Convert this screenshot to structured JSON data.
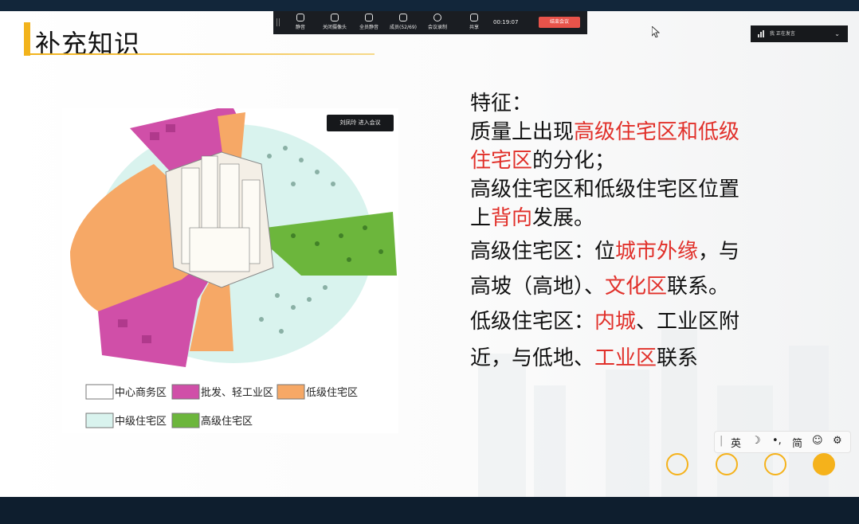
{
  "slide": {
    "title": "补充知识",
    "notes": {
      "heading": "特征：",
      "l1a": "质量上出现",
      "l1b": "高级住宅区和低级",
      "l2a": "住宅区",
      "l2b": "的分化；",
      "l3": "高级住宅区和低级住宅区位置",
      "l4a": "上",
      "l4b": "背向",
      "l4c": "发展。",
      "l5a": "高级住宅区：位",
      "l5b": "城市外缘",
      "l5c": "，与",
      "l6a": "高坡（高地）、",
      "l6b": "文化区",
      "l6c": "联系。",
      "l7a": "低级住宅区：",
      "l7b": "内城",
      "l7c": "、工业区附",
      "l8a": "近，与低地、",
      "l8b": "工业区",
      "l8c": "联系"
    },
    "legend": {
      "cbd": "中心商务区",
      "industry": "批发、轻工业区",
      "low": "低级住宅区",
      "mid": "中级住宅区",
      "high": "高级住宅区"
    }
  },
  "colors": {
    "accent": "#f2b31c",
    "red_text": "#e1302a",
    "cbd": "#ffffff",
    "industry": "#d04fa8",
    "low": "#f6a866",
    "mid": "#d9f3ee",
    "high": "#6cb63c"
  },
  "meeting_toolbar": {
    "items": [
      "静音",
      "关闭摄像头",
      "全员静音",
      "成员(52/69)",
      "会议录制",
      "共享"
    ],
    "icons": [
      "microphone-icon",
      "camera-icon",
      "mute-all-icon",
      "members-icon",
      "record-icon",
      "share-icon"
    ],
    "time": "00:19:07",
    "end_button": "结束会议"
  },
  "speaker": {
    "label": "我 正在发言"
  },
  "toast": "刘凤玲 进入会议",
  "ime": {
    "items": [
      "英",
      "☽",
      "•,",
      "简",
      "☺",
      "⚙"
    ]
  }
}
